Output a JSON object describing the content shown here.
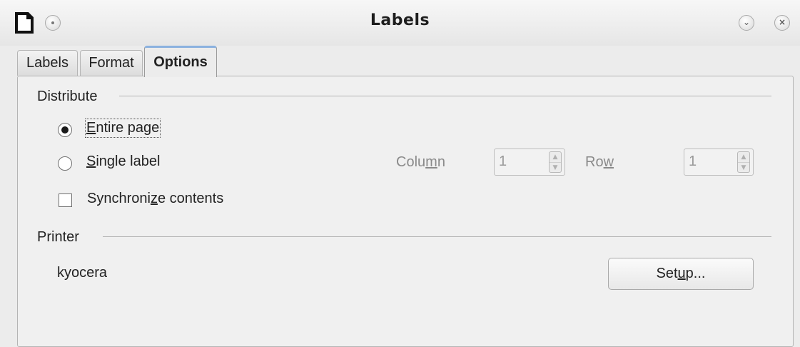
{
  "window": {
    "title": "Labels",
    "minimize_glyph": "⌄",
    "close_glyph": "×"
  },
  "tabs": [
    {
      "label": "Labels",
      "active": false
    },
    {
      "label": "Format",
      "active": false
    },
    {
      "label": "Options",
      "active": true
    }
  ],
  "distribute": {
    "heading": "Distribute",
    "entire_page": {
      "label_u": "E",
      "label_rest": "ntire page",
      "selected": true
    },
    "single_label": {
      "label_u": "S",
      "label_rest": "ingle label",
      "selected": false
    },
    "synchronize": {
      "label_pre": "Synchroni",
      "label_u": "z",
      "label_post": "e contents",
      "checked": false
    },
    "column": {
      "label_pre": "Colu",
      "label_u": "m",
      "label_post": "n",
      "value": "1"
    },
    "row": {
      "label_pre": "Ro",
      "label_u": "w",
      "label_post": "",
      "value": "1"
    }
  },
  "printer": {
    "heading": "Printer",
    "name": "kyocera",
    "setup_pre": "Set",
    "setup_u": "u",
    "setup_post": "p..."
  },
  "icons": {
    "app": "document-icon",
    "spin_up": "▲",
    "spin_down": "▼"
  }
}
